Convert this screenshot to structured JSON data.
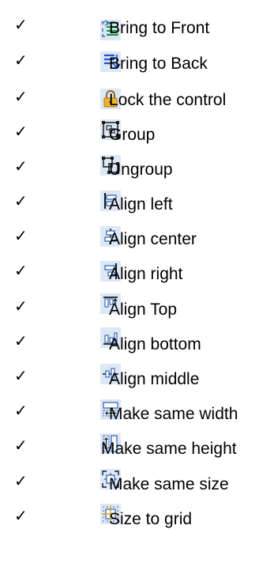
{
  "check_mark": "✓",
  "items": [
    {
      "label": "Bring to Front",
      "icon": "bring-to-front-icon"
    },
    {
      "label": "Bring to Back",
      "icon": "bring-to-back-icon"
    },
    {
      "label": "Lock the control",
      "icon": "lock-icon"
    },
    {
      "label": "Group",
      "icon": "group-icon"
    },
    {
      "label": "Ungroup",
      "icon": "ungroup-icon"
    },
    {
      "label": "Align left",
      "icon": "align-left-icon"
    },
    {
      "label": "Align center",
      "icon": "align-center-icon"
    },
    {
      "label": "Align right",
      "icon": "align-right-icon"
    },
    {
      "label": "Align Top",
      "icon": "align-top-icon"
    },
    {
      "label": "Align bottom",
      "icon": "align-bottom-icon"
    },
    {
      "label": "Align middle",
      "icon": "align-middle-icon"
    },
    {
      "label": "Make same width",
      "icon": "make-same-width-icon"
    },
    {
      "label": "Make same height",
      "icon": "make-same-height-icon"
    },
    {
      "label": "Make same size",
      "icon": "make-same-size-icon"
    },
    {
      "label": "Size to grid",
      "icon": "size-to-grid-icon"
    }
  ]
}
